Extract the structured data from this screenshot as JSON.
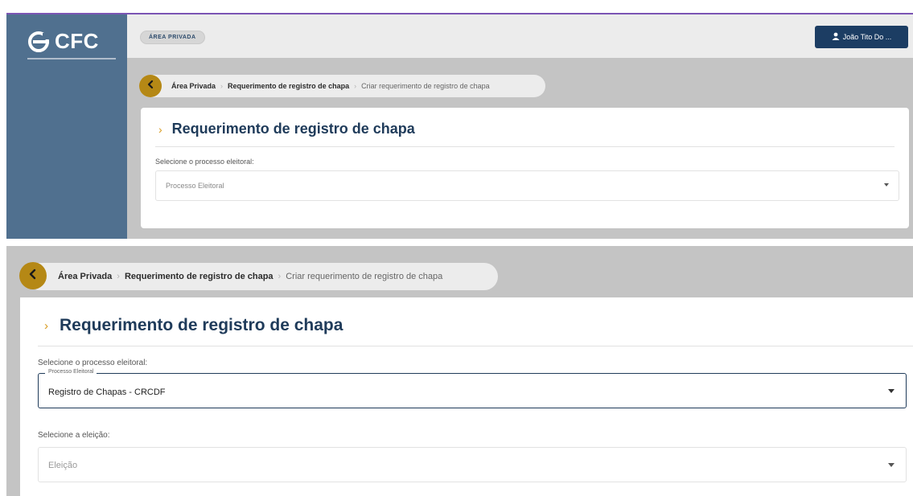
{
  "panel1": {
    "logo_text": "CFC",
    "header_chip": "ÁREA PRIVADA",
    "user_button": "João Tito Do ...",
    "breadcrumb": {
      "items": [
        "Área Privada",
        "Requerimento de registro de chapa"
      ],
      "current": "Criar requerimento de registro de chapa"
    },
    "title": "Requerimento de registro de chapa",
    "process_label": "Selecione o processo eleitoral:",
    "process_select_placeholder": "Processo Eleitoral"
  },
  "panel2": {
    "breadcrumb": {
      "items": [
        "Área Privada",
        "Requerimento de registro de chapa"
      ],
      "current": "Criar requerimento de registro de chapa"
    },
    "title": "Requerimento de registro de chapa",
    "process_label": "Selecione o processo eleitoral:",
    "process_select_float_label": "Processo Eleitoral",
    "process_select_value": "Registro de Chapas - CRCDF",
    "election_label": "Selecione a eleição:",
    "election_select_placeholder": "Eleição"
  },
  "colors": {
    "sidebar": "#50708f",
    "accent_gold": "#b58815",
    "title_navy": "#1f3b5a",
    "user_button": "#1c3d63",
    "top_accent": "#7b55b4"
  }
}
